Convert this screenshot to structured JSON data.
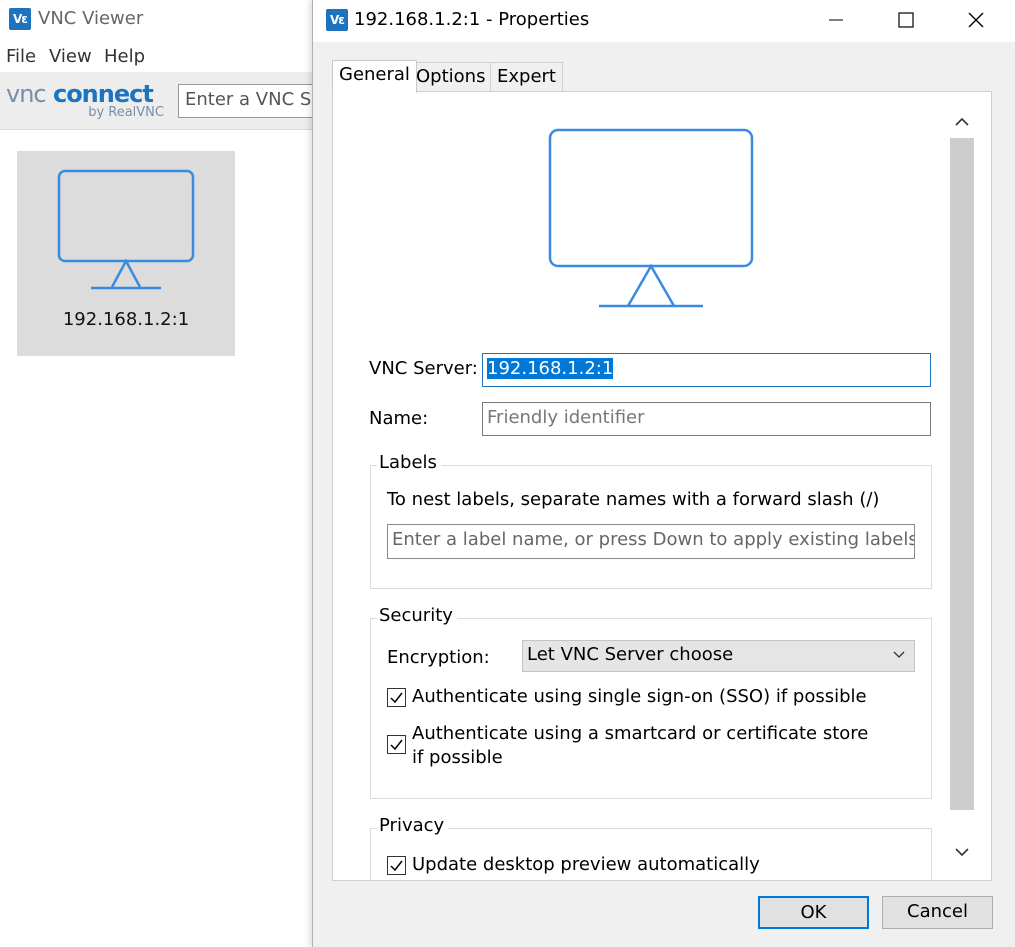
{
  "main_window": {
    "title": "VNC Viewer",
    "menu": [
      "File",
      "View",
      "Help"
    ],
    "brand": {
      "logo_vnc": "vnc",
      "logo_connect": "connect",
      "byline": "by RealVNC"
    },
    "search": {
      "value": "Enter a VNC Se"
    },
    "connections": [
      {
        "label": "192.168.1.2:1"
      }
    ]
  },
  "dialog": {
    "title": "192.168.1.2:1 - Properties",
    "icon": "vnc-app-icon",
    "tabs": [
      {
        "label": "General",
        "active": true
      },
      {
        "label": "Options",
        "active": false
      },
      {
        "label": "Expert",
        "active": false
      }
    ],
    "general": {
      "server_label": "VNC Server:",
      "server_value": "192.168.1.2:1",
      "name_label": "Name:",
      "name_placeholder": "Friendly identifier",
      "labels": {
        "title": "Labels",
        "hint": "To nest labels, separate names with a forward slash (/)",
        "input_placeholder": "Enter a label name, or press Down to apply existing labels"
      },
      "security": {
        "title": "Security",
        "encryption_label": "Encryption:",
        "encryption_value": "Let VNC Server choose",
        "sso_label": "Authenticate using single sign-on (SSO) if possible",
        "sso_checked": true,
        "smartcard_label": "Authenticate using a smartcard or certificate store if possible",
        "smartcard_checked": true
      },
      "privacy": {
        "title": "Privacy",
        "preview_label": "Update desktop preview automatically",
        "preview_checked": true
      }
    },
    "buttons": {
      "ok": "OK",
      "cancel": "Cancel"
    }
  },
  "colors": {
    "accent": "#1e73be",
    "selection": "#0078d7",
    "tile_bg": "#dcdcdc"
  }
}
